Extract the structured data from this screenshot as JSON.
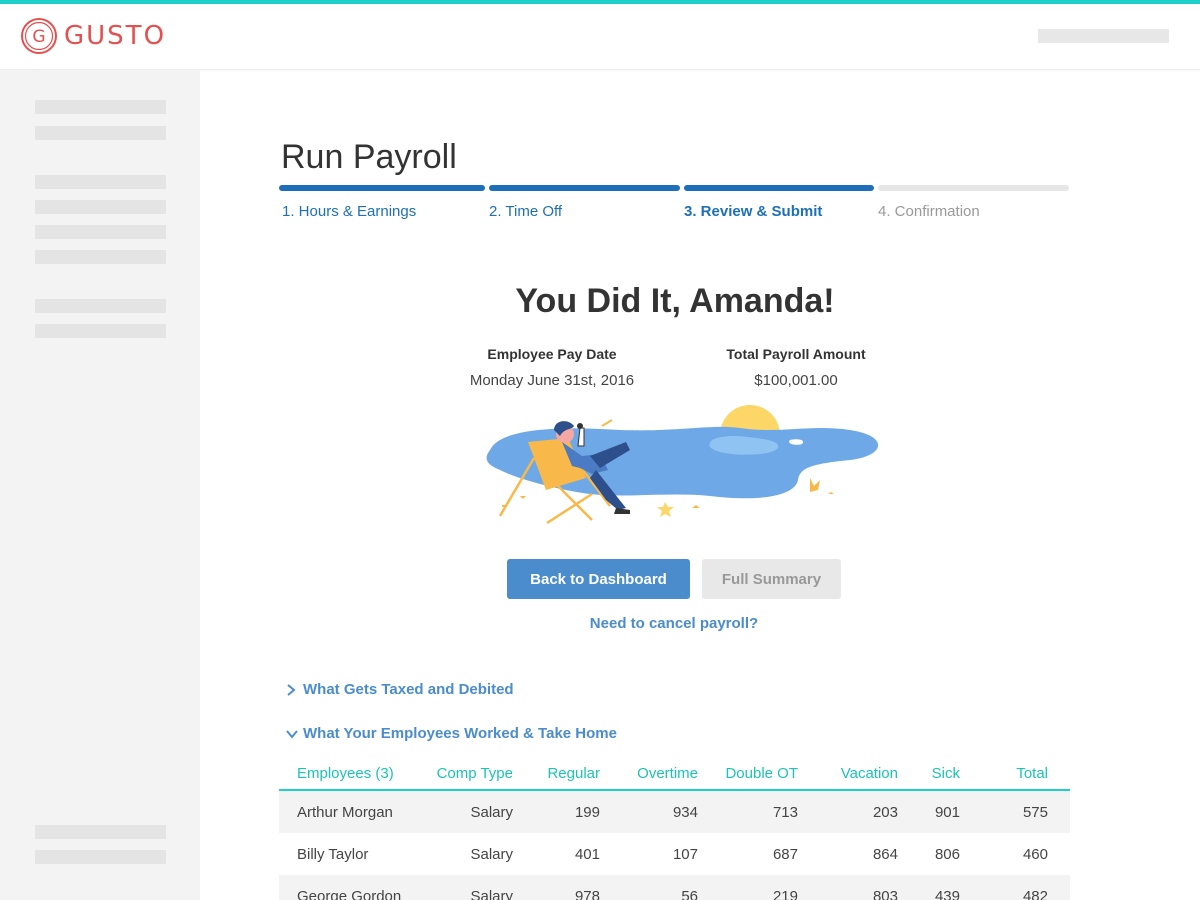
{
  "brand": {
    "name": "GUSTO",
    "color": "#e4504f",
    "accent": "#1ccfc9",
    "primary": "#1c6fb8"
  },
  "page": {
    "title": "Run Payroll"
  },
  "steps": [
    {
      "label": "1. Hours & Earnings",
      "state": "done"
    },
    {
      "label": "2. Time Off",
      "state": "done"
    },
    {
      "label": "3. Review & Submit",
      "state": "current"
    },
    {
      "label": "4. Confirmation",
      "state": "todo"
    }
  ],
  "hero": {
    "title": "You Did It, Amanda!",
    "pay_date_label": "Employee Pay Date",
    "pay_date_value": "Monday June 31st, 2016",
    "total_label": "Total Payroll Amount",
    "total_value": "$100,001.00"
  },
  "actions": {
    "back_label": "Back to Dashboard",
    "summary_label": "Full Summary",
    "cancel_label": "Need to cancel payroll?"
  },
  "sections": [
    {
      "label": "What Gets Taxed and Debited",
      "expanded": false
    },
    {
      "label": "What Your Employees Worked & Take Home",
      "expanded": true
    }
  ],
  "table": {
    "columns": [
      "Employees (3)",
      "Comp Type",
      "Regular",
      "Overtime",
      "Double OT",
      "Vacation",
      "Sick",
      "Total"
    ],
    "rows": [
      [
        "Arthur Morgan",
        "Salary",
        "199",
        "934",
        "713",
        "203",
        "901",
        "575"
      ],
      [
        "Billy Taylor",
        "Salary",
        "401",
        "107",
        "687",
        "864",
        "806",
        "460"
      ],
      [
        "George Gordon",
        "Salary",
        "978",
        "56",
        "219",
        "803",
        "439",
        "482"
      ]
    ]
  }
}
